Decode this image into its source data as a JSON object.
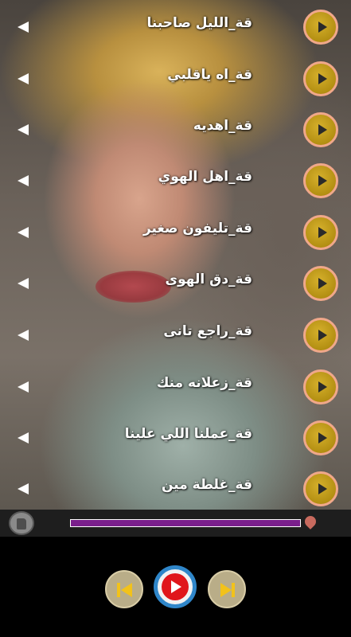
{
  "songs": [
    {
      "title": "قة_الليل صاحبنا"
    },
    {
      "title": "قة_اه ياقلبي"
    },
    {
      "title": "قة_اهديه"
    },
    {
      "title": "قة_اهل الهوي"
    },
    {
      "title": "قة_تليفون صغير"
    },
    {
      "title": "قة_دق الهوى"
    },
    {
      "title": "قة_راجع تانى"
    },
    {
      "title": "قة_زعلانه منك"
    },
    {
      "title": "قة_عملنا اللي علينا"
    },
    {
      "title": "قة_غلطة مين"
    }
  ],
  "player": {
    "progress": 1.0
  },
  "icons": {
    "row_play": "play-circle-icon",
    "row_arrow": "left-arrow-icon",
    "like": "thumbs-up-icon",
    "seek_marker": "location-pin-icon",
    "prev": "skip-previous-icon",
    "play": "play-icon",
    "next": "skip-next-icon"
  },
  "colors": {
    "play_gold": "#b38f12",
    "play_ring": "#f0a88a",
    "seek_fill": "#7a1f8c",
    "main_play_red": "#e0161b",
    "main_play_ring": "#2f86c9"
  }
}
